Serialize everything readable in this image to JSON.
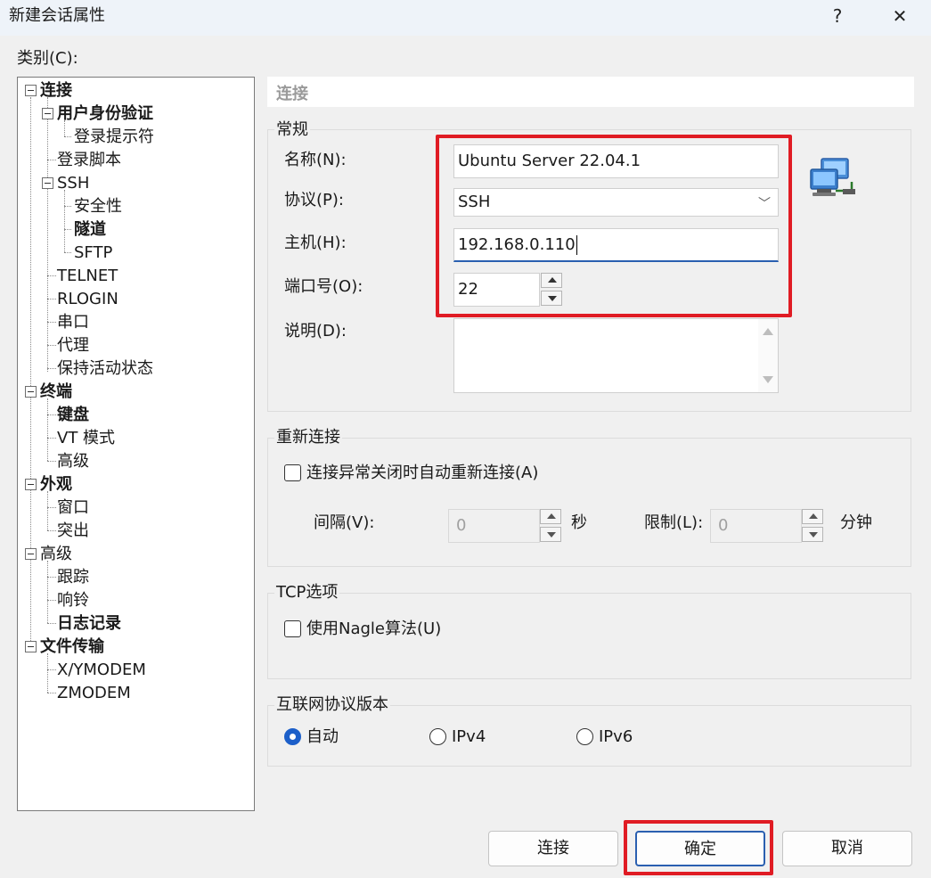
{
  "window": {
    "title": "新建会话属性",
    "help_label": "?",
    "close_label": "✕"
  },
  "category_label": "类别(C):",
  "tree": {
    "items": [
      {
        "label": "连接",
        "bold": true
      },
      {
        "label": "用户身份验证",
        "bold": true
      },
      {
        "label": "登录提示符",
        "bold": false
      },
      {
        "label": "登录脚本",
        "bold": false
      },
      {
        "label": "SSH",
        "bold": false
      },
      {
        "label": "安全性",
        "bold": false
      },
      {
        "label": "隧道",
        "bold": true
      },
      {
        "label": "SFTP",
        "bold": false
      },
      {
        "label": "TELNET",
        "bold": false
      },
      {
        "label": "RLOGIN",
        "bold": false
      },
      {
        "label": "串口",
        "bold": false
      },
      {
        "label": "代理",
        "bold": false
      },
      {
        "label": "保持活动状态",
        "bold": false
      },
      {
        "label": "终端",
        "bold": true
      },
      {
        "label": "键盘",
        "bold": true
      },
      {
        "label": "VT 模式",
        "bold": false
      },
      {
        "label": "高级",
        "bold": false
      },
      {
        "label": "外观",
        "bold": true
      },
      {
        "label": "窗口",
        "bold": false
      },
      {
        "label": "突出",
        "bold": false
      },
      {
        "label": "高级",
        "bold": false
      },
      {
        "label": "跟踪",
        "bold": false
      },
      {
        "label": "响铃",
        "bold": false
      },
      {
        "label": "日志记录",
        "bold": true
      },
      {
        "label": "文件传输",
        "bold": true
      },
      {
        "label": "X/YMODEM",
        "bold": false
      },
      {
        "label": "ZMODEM",
        "bold": false
      }
    ]
  },
  "section_title": "连接",
  "general": {
    "title": "常规",
    "name_label": "名称(N):",
    "name_value": "Ubuntu Server 22.04.1",
    "protocol_label": "协议(P):",
    "protocol_value": "SSH",
    "host_label": "主机(H):",
    "host_value": "192.168.0.110",
    "port_label": "端口号(O):",
    "port_value": "22",
    "desc_label": "说明(D):",
    "desc_value": ""
  },
  "reconnect": {
    "title": "重新连接",
    "checkbox_label": "连接异常关闭时自动重新连接(A)",
    "interval_label": "间隔(V):",
    "interval_value": "0",
    "interval_unit": "秒",
    "limit_label": "限制(L):",
    "limit_value": "0",
    "limit_unit": "分钟"
  },
  "tcp": {
    "title": "TCP选项",
    "nagle_label": "使用Nagle算法(U)"
  },
  "ip_version": {
    "title": "互联网协议版本",
    "options": [
      "自动",
      "IPv4",
      "IPv6"
    ],
    "selected": "自动"
  },
  "buttons": {
    "connect": "连接",
    "ok": "确定",
    "cancel": "取消"
  },
  "colors": {
    "highlight": "#e01c24",
    "accent": "#2a5fb0"
  }
}
